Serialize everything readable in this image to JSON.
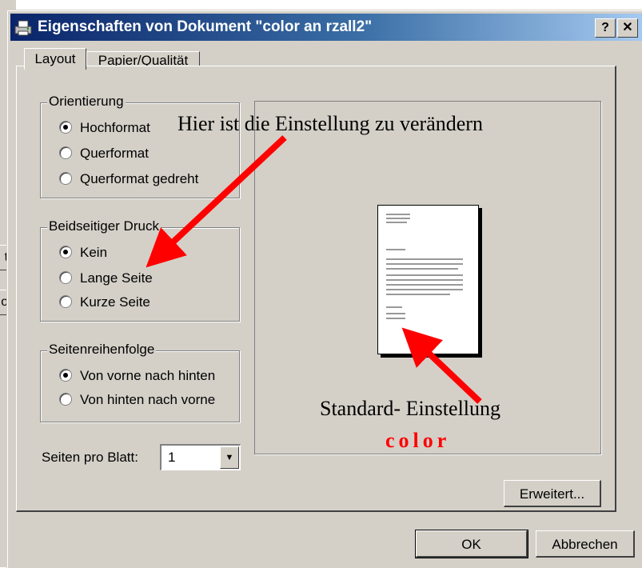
{
  "window": {
    "title": "Eigenschaften von Dokument \"color an rzall2\"",
    "help_label": "?",
    "close_label": "✕"
  },
  "background_window": {
    "fragment_1": "te",
    "fragment_2": "ob"
  },
  "tabs": [
    {
      "label": "Layout",
      "active": true
    },
    {
      "label": "Papier/Qualität",
      "active": false
    }
  ],
  "orientation": {
    "legend": "Orientierung",
    "options": [
      {
        "label": "Hochformat",
        "selected": true
      },
      {
        "label": "Querformat",
        "selected": false
      },
      {
        "label": "Querformat gedreht",
        "selected": false
      }
    ]
  },
  "duplex": {
    "legend": "Beidseitiger Druck",
    "options": [
      {
        "label": "Kein",
        "selected": true
      },
      {
        "label": "Lange Seite",
        "selected": false
      },
      {
        "label": "Kurze Seite",
        "selected": false
      }
    ]
  },
  "page_order": {
    "legend": "Seitenreihenfolge",
    "options": [
      {
        "label": "Von vorne nach hinten",
        "selected": true
      },
      {
        "label": "Von hinten nach vorne",
        "selected": false
      }
    ]
  },
  "pages_per_sheet": {
    "label": "Seiten pro Blatt:",
    "value": "1"
  },
  "buttons": {
    "advanced": "Erweitert...",
    "ok": "OK",
    "cancel": "Abbrechen"
  },
  "annotations": {
    "top_note": "Hier ist die Einstellung zu verändern",
    "bottom_note": "Standard- Einstellung",
    "color_word": "color",
    "arrow_color": "#ff0000"
  }
}
